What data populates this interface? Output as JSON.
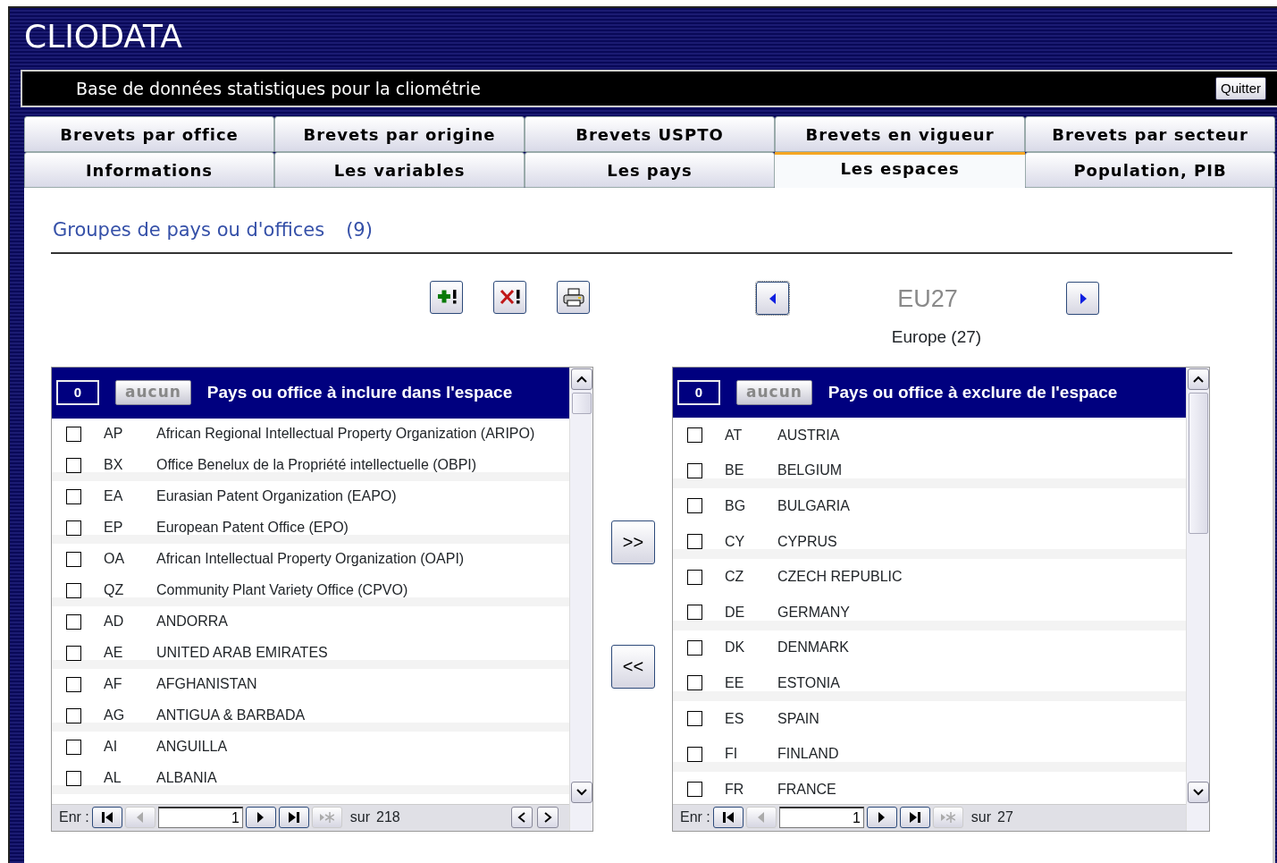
{
  "app_title": "CLIODATA",
  "subtitle": "Base de données statistiques pour la cliométrie",
  "quit_button": "Quitter",
  "tab_rows": [
    {
      "tabs": [
        {
          "label": "Brevets par office",
          "selected": false
        },
        {
          "label": "Brevets par origine",
          "selected": false
        },
        {
          "label": "Brevets USPTO",
          "selected": false
        },
        {
          "label": "Brevets en vigueur",
          "selected": false
        },
        {
          "label": "Brevets par secteur",
          "selected": false
        }
      ]
    },
    {
      "tabs": [
        {
          "label": "Informations",
          "selected": false
        },
        {
          "label": "Les variables",
          "selected": false
        },
        {
          "label": "Les pays",
          "selected": false
        },
        {
          "label": "Les espaces",
          "selected": true
        },
        {
          "label": "Population, PIB",
          "selected": false
        }
      ]
    }
  ],
  "section": {
    "heading": "Groupes de pays ou d'offices",
    "count": "(9)"
  },
  "toolbar": [
    {
      "kind": "add"
    },
    {
      "kind": "delete"
    },
    {
      "kind": "print"
    }
  ],
  "group_nav": {
    "code": "EU27",
    "name": "Europe (27)"
  },
  "move_buttons": [
    ">>",
    "<<"
  ],
  "lists": [
    {
      "counter": "0",
      "clear_button": "aucun",
      "title": "Pays ou office à inclure dans l'espace",
      "horizontal_scroll": true,
      "rows": [
        {
          "code": "AP",
          "name": "African Regional Intellectual Property Organization (ARIPO)",
          "checked": false
        },
        {
          "code": "BX",
          "name": "Office Benelux de la Propriété intellectuelle (OBPI)",
          "checked": false
        },
        {
          "code": "EA",
          "name": "Eurasian Patent Organization (EAPO)",
          "checked": false
        },
        {
          "code": "EP",
          "name": "European Patent Office (EPO)",
          "checked": false
        },
        {
          "code": "OA",
          "name": "African Intellectual Property Organization (OAPI)",
          "checked": false
        },
        {
          "code": "QZ",
          "name": "Community Plant Variety Office (CPVO)",
          "checked": false
        },
        {
          "code": "AD",
          "name": "ANDORRA",
          "checked": false
        },
        {
          "code": "AE",
          "name": "UNITED ARAB EMIRATES",
          "checked": false
        },
        {
          "code": "AF",
          "name": "AFGHANISTAN",
          "checked": false
        },
        {
          "code": "AG",
          "name": "ANTIGUA & BARBADA",
          "checked": false
        },
        {
          "code": "AI",
          "name": "ANGUILLA",
          "checked": false
        },
        {
          "code": "AL",
          "name": "ALBANIA",
          "checked": false
        }
      ],
      "nav": {
        "label": "Enr :",
        "record": "1",
        "of": "sur",
        "total": "218"
      }
    },
    {
      "counter": "0",
      "clear_button": "aucun",
      "title": "Pays ou office à exclure de l'espace",
      "horizontal_scroll": false,
      "rows": [
        {
          "code": "AT",
          "name": "AUSTRIA",
          "checked": false
        },
        {
          "code": "BE",
          "name": "BELGIUM",
          "checked": false
        },
        {
          "code": "BG",
          "name": "BULGARIA",
          "checked": false
        },
        {
          "code": "CY",
          "name": "CYPRUS",
          "checked": false
        },
        {
          "code": "CZ",
          "name": "CZECH REPUBLIC",
          "checked": false
        },
        {
          "code": "DE",
          "name": "GERMANY",
          "checked": false
        },
        {
          "code": "DK",
          "name": "DENMARK",
          "checked": false
        },
        {
          "code": "EE",
          "name": "ESTONIA",
          "checked": false
        },
        {
          "code": "ES",
          "name": "SPAIN",
          "checked": false
        },
        {
          "code": "FI",
          "name": "FINLAND",
          "checked": false
        },
        {
          "code": "FR",
          "name": "FRANCE",
          "checked": false
        }
      ],
      "nav": {
        "label": "Enr :",
        "record": "1",
        "of": "sur",
        "total": "27"
      }
    }
  ]
}
